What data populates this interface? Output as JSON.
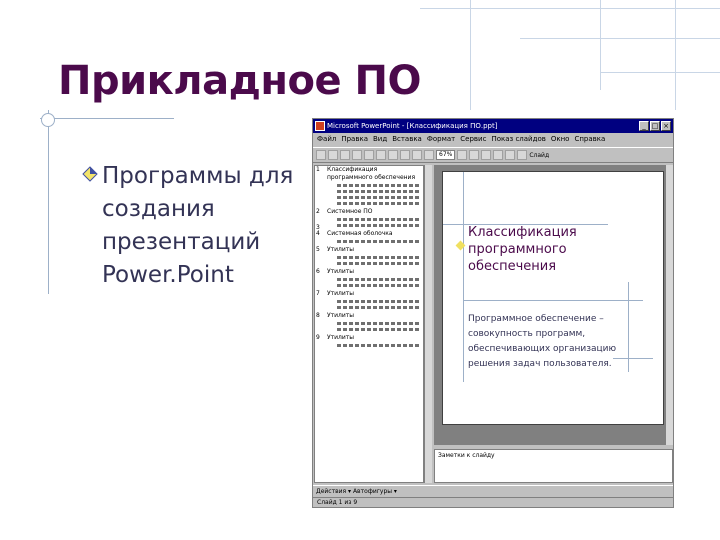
{
  "slide": {
    "title": "Прикладное ПО",
    "bullet_lines": [
      "Программы для",
      "создания",
      "презентаций",
      "Power.Point"
    ]
  },
  "colors": {
    "title": "#4b0a4b",
    "body_text": "#333355",
    "accent_lines": "#9db0c8",
    "window_titlebar": "#000080"
  },
  "ppt_window": {
    "title": "Microsoft PowerPoint - [Классификация ПО.ppt]",
    "menu": [
      "Файл",
      "Правка",
      "Вид",
      "Вставка",
      "Формат",
      "Сервис",
      "Показ слайдов",
      "Окно",
      "Справка"
    ],
    "zoom": "67%",
    "toolbar_label": "Слайд",
    "outline_items": [
      {
        "num": "1",
        "text": "Классификация программного обеспечения"
      },
      {
        "num": "2",
        "text": "Системное ПО"
      },
      {
        "num": "3",
        "text": ""
      },
      {
        "num": "4",
        "text": "Системная оболочка"
      },
      {
        "num": "5",
        "text": "Утилиты"
      },
      {
        "num": "6",
        "text": "Утилиты"
      },
      {
        "num": "7",
        "text": "Утилиты"
      },
      {
        "num": "8",
        "text": "Утилиты"
      },
      {
        "num": "9",
        "text": "Утилиты"
      }
    ],
    "mini_slide": {
      "title": "Классификация программного обеспечения",
      "body": "Программное обеспечение – совокупность программ, обеспечивающих организацию решения задач пользователя."
    },
    "notes_placeholder": "Заметки к слайду",
    "draw_bar": "Действия ▾   Автофигуры ▾",
    "status": "Слайд 1 из 9"
  }
}
